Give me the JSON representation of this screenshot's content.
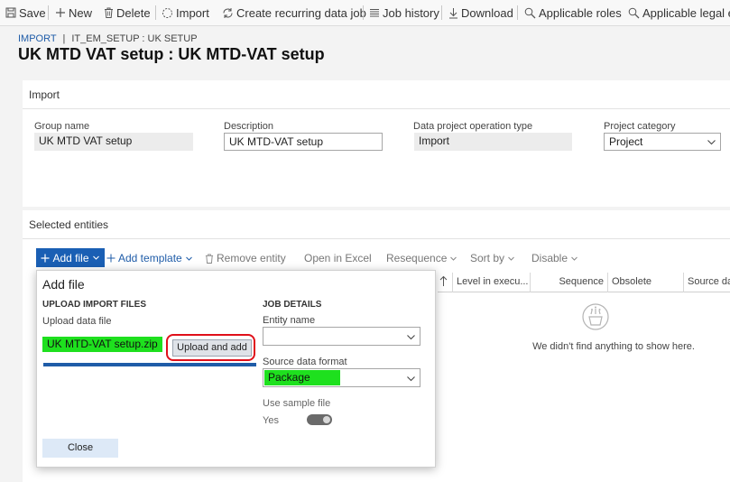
{
  "action_bar": {
    "items": [
      {
        "label": "Save",
        "icon": "save-icon"
      },
      {
        "label": "New",
        "icon": "plus-icon"
      },
      {
        "label": "Delete",
        "icon": "trash-icon"
      },
      {
        "label": "Import",
        "icon": "import-icon"
      },
      {
        "label": "Create recurring data job",
        "icon": "recurring-icon"
      },
      {
        "label": "Job history",
        "icon": "list-icon"
      },
      {
        "label": "Download",
        "icon": "download-icon"
      },
      {
        "label": "Applicable roles",
        "icon": "search-icon"
      },
      {
        "label": "Applicable legal en",
        "icon": "search-icon"
      }
    ]
  },
  "breadcrumb": {
    "link": "IMPORT",
    "separator": "|",
    "current": "IT_EM_SETUP : UK SETUP"
  },
  "page_title": "UK MTD VAT setup : UK MTD-VAT setup",
  "import_section": {
    "header": "Import",
    "group_name": {
      "label": "Group name",
      "value": "UK MTD VAT setup"
    },
    "description": {
      "label": "Description",
      "value": "UK MTD-VAT setup"
    },
    "operation_type": {
      "label": "Data project operation type",
      "value": "Import"
    },
    "project_category": {
      "label": "Project category",
      "value": "Project"
    }
  },
  "entities_section": {
    "header": "Selected entities",
    "toolbar": {
      "add_file": "Add file",
      "add_template": "Add template",
      "remove_entity": "Remove entity",
      "open_in_excel": "Open in Excel",
      "resequence": "Resequence",
      "sort_by": "Sort by",
      "disable": "Disable"
    },
    "grid_columns": [
      "Level in execu...",
      "Sequence",
      "Obsolete",
      "Source da"
    ],
    "empty_message": "We didn't find anything to show here."
  },
  "add_file_panel": {
    "title": "Add file",
    "upload_section": "UPLOAD IMPORT FILES",
    "upload_label": "Upload data file",
    "file_name": "UK MTD-VAT setup.zip",
    "upload_button": "Upload and add",
    "upload_progress": 1.0,
    "job_section": "JOB DETAILS",
    "entity_name_label": "Entity name",
    "entity_name_value": "",
    "source_format_label": "Source data format",
    "source_format_value": "Package",
    "sample_file_label": "Use sample file",
    "sample_file_value": "Yes",
    "sample_file_on": true,
    "close_button": "Close"
  },
  "colors": {
    "accent_blue": "#1a5fb4",
    "highlight_green": "#1ee01e",
    "annotation_red": "#e0101a",
    "close_button_bg": "#dde9f7"
  }
}
